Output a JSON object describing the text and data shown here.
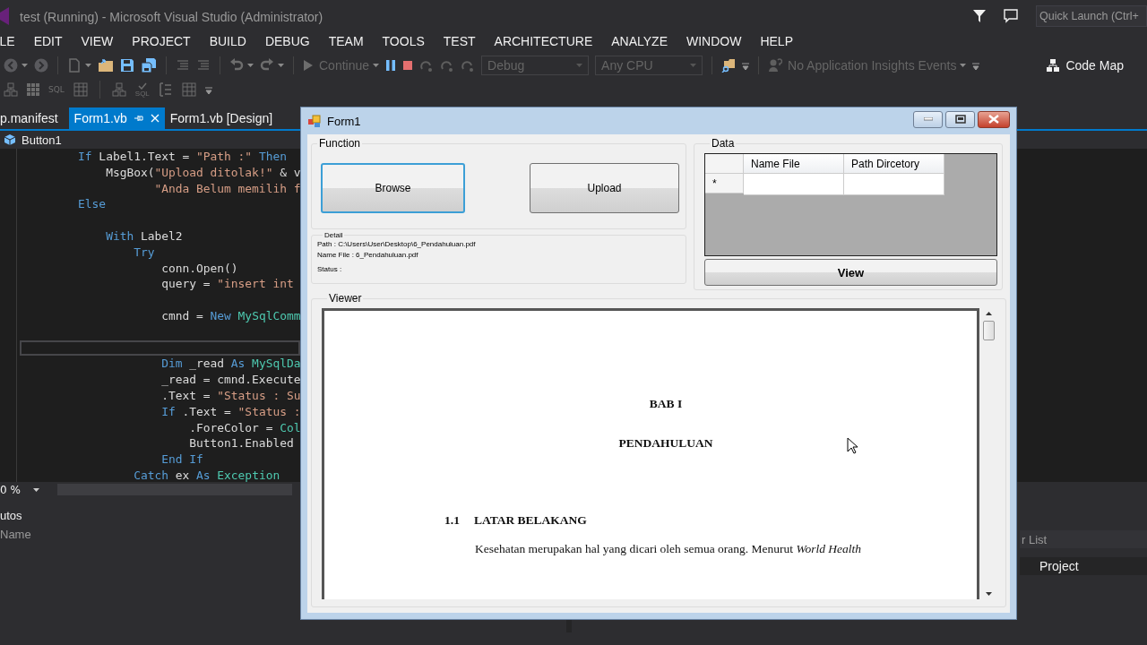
{
  "window": {
    "title": "test (Running) - Microsoft Visual Studio (Administrator)"
  },
  "quick_launch": {
    "placeholder": "Quick Launch (Ctrl+"
  },
  "menu": [
    "LE",
    "EDIT",
    "VIEW",
    "PROJECT",
    "BUILD",
    "DEBUG",
    "TEAM",
    "TOOLS",
    "TEST",
    "ARCHITECTURE",
    "ANALYZE",
    "WINDOW",
    "HELP"
  ],
  "toolbar": [
    {
      "kind": "back"
    },
    {
      "kind": "caret"
    },
    {
      "kind": "forward"
    },
    {
      "kind": "sep"
    },
    {
      "kind": "document"
    },
    {
      "kind": "caret"
    },
    {
      "kind": "folder"
    },
    {
      "kind": "save"
    },
    {
      "kind": "saveall"
    },
    {
      "kind": "sep"
    },
    {
      "kind": "lines"
    },
    {
      "kind": "lines"
    },
    {
      "kind": "sep"
    },
    {
      "kind": "undo"
    },
    {
      "kind": "caret"
    },
    {
      "kind": "redo"
    },
    {
      "kind": "caret"
    },
    {
      "kind": "sep"
    },
    {
      "kind": "continue",
      "label": "Continue"
    },
    {
      "kind": "caret"
    },
    {
      "kind": "pause"
    },
    {
      "kind": "stop"
    },
    {
      "kind": "step"
    },
    {
      "kind": "step"
    },
    {
      "kind": "step"
    },
    {
      "kind": "combo",
      "label": "Debug"
    },
    {
      "kind": "combo",
      "label": "Any CPU"
    },
    {
      "kind": "sep"
    },
    {
      "kind": "find"
    },
    {
      "kind": "more"
    },
    {
      "kind": "sep"
    },
    {
      "kind": "insights",
      "label": "No Application Insights Events"
    },
    {
      "kind": "caret"
    },
    {
      "kind": "more"
    },
    {
      "kind": "gap"
    },
    {
      "kind": "codemap",
      "label": "Code Map"
    }
  ],
  "toolbar2": [
    {
      "kind": "diagram"
    },
    {
      "kind": "grid"
    },
    {
      "kind": "text",
      "label": "SQL"
    },
    {
      "kind": "table"
    },
    {
      "kind": "sep"
    },
    {
      "kind": "diagram"
    },
    {
      "kind": "sqlcheck",
      "label": "SQL"
    },
    {
      "kind": "columns"
    },
    {
      "kind": "table"
    },
    {
      "kind": "more"
    }
  ],
  "tabs": [
    {
      "label": "p.manifest",
      "selected": false
    },
    {
      "label": "Form1.vb",
      "selected": true
    },
    {
      "label": "Form1.vb [Design]",
      "selected": false
    }
  ],
  "navigation": {
    "member": "Button1"
  },
  "editor": {
    "lines": [
      {
        "current": false,
        "tokens": [
          {
            "kind": "keyword",
            "text": "        If"
          },
          {
            "kind": "plain",
            "text": " Label1.Text = "
          },
          {
            "kind": "string",
            "text": "\"Path :\""
          },
          {
            "kind": "keyword",
            "text": " Then"
          }
        ]
      },
      {
        "current": false,
        "tokens": [
          {
            "kind": "plain",
            "text": "            MsgBox("
          },
          {
            "kind": "string",
            "text": "\"Upload ditolak!\""
          },
          {
            "kind": "plain",
            "text": " & v"
          }
        ]
      },
      {
        "current": false,
        "tokens": [
          {
            "kind": "string",
            "text": "                   \"Anda Belum memilih f"
          }
        ]
      },
      {
        "current": false,
        "tokens": [
          {
            "kind": "keyword",
            "text": "        Else"
          }
        ]
      },
      {
        "current": false
      },
      {
        "current": false,
        "tokens": [
          {
            "kind": "keyword",
            "text": "            With"
          },
          {
            "kind": "plain",
            "text": " Label2"
          }
        ]
      },
      {
        "current": false,
        "tokens": [
          {
            "kind": "keyword",
            "text": "                Try"
          }
        ]
      },
      {
        "current": false,
        "tokens": [
          {
            "kind": "plain",
            "text": "                    conn.Open()"
          }
        ]
      },
      {
        "current": false,
        "tokens": [
          {
            "kind": "plain",
            "text": "                    query = "
          },
          {
            "kind": "string",
            "text": "\"insert int"
          }
        ]
      },
      {
        "current": false
      },
      {
        "current": false,
        "tokens": [
          {
            "kind": "plain",
            "text": "                    cmnd = "
          },
          {
            "kind": "keyword",
            "text": "New"
          },
          {
            "kind": "type",
            "text": " MySqlComm"
          }
        ]
      },
      {
        "current": false
      },
      {
        "current": true
      },
      {
        "current": false,
        "tokens": [
          {
            "kind": "keyword",
            "text": "                    Dim"
          },
          {
            "kind": "plain",
            "text": " _read "
          },
          {
            "kind": "keyword",
            "text": "As"
          },
          {
            "kind": "type",
            "text": " MySqlDa"
          }
        ]
      },
      {
        "current": false,
        "tokens": [
          {
            "kind": "plain",
            "text": "                    _read = cmnd.Execute"
          }
        ]
      },
      {
        "current": false,
        "tokens": [
          {
            "kind": "plain",
            "text": "                    .Text = "
          },
          {
            "kind": "string",
            "text": "\"Status : Su"
          }
        ]
      },
      {
        "current": false,
        "tokens": [
          {
            "kind": "keyword",
            "text": "                    If"
          },
          {
            "kind": "plain",
            "text": " .Text = "
          },
          {
            "kind": "string",
            "text": "\"Status :"
          }
        ]
      },
      {
        "current": false,
        "tokens": [
          {
            "kind": "plain",
            "text": "                        .ForeColor = "
          },
          {
            "kind": "type",
            "text": "Col"
          }
        ]
      },
      {
        "current": false,
        "tokens": [
          {
            "kind": "plain",
            "text": "                        Button1.Enabled"
          }
        ]
      },
      {
        "current": false,
        "tokens": [
          {
            "kind": "keyword",
            "text": "                    End If"
          }
        ]
      },
      {
        "current": false,
        "tokens": [
          {
            "kind": "keyword",
            "text": "                Catch"
          },
          {
            "kind": "plain",
            "text": " ex "
          },
          {
            "kind": "keyword",
            "text": "As"
          },
          {
            "kind": "type",
            "text": " Exception"
          }
        ]
      }
    ],
    "zoom": "0 %"
  },
  "autos_panel": {
    "title": "utos",
    "column": "Name"
  },
  "error_list": {
    "search_placeholder": "r List",
    "column": "Project"
  },
  "form": {
    "title": "Form1",
    "function": {
      "legend": "Function",
      "buttons": [
        {
          "label": "Browse",
          "focused": true
        },
        {
          "label": "Upload",
          "focused": false
        }
      ]
    },
    "detail": {
      "legend": "Detail",
      "lines": [
        "Path : C:\\Users\\User\\Desktop\\6_Pendahuluan.pdf",
        "Name File : 6_Pendahuluan.pdf",
        "Status :"
      ]
    },
    "data": {
      "legend": "Data",
      "columns": [
        "Name File",
        "Path Dircetory"
      ],
      "new_row_marker": "*",
      "view_button": "View"
    },
    "viewer": {
      "legend": "Viewer",
      "document": [
        {
          "kind": "heading",
          "text": "BAB I"
        },
        {
          "kind": "heading",
          "text": "PENDAHULUAN"
        },
        {
          "kind": "section",
          "number": "1.1",
          "text": "LATAR BELAKANG"
        },
        {
          "kind": "paragraph",
          "text": "Kesehatan merupakan hal yang dicari oleh semua orang. Menurut *World Health*"
        }
      ]
    }
  }
}
